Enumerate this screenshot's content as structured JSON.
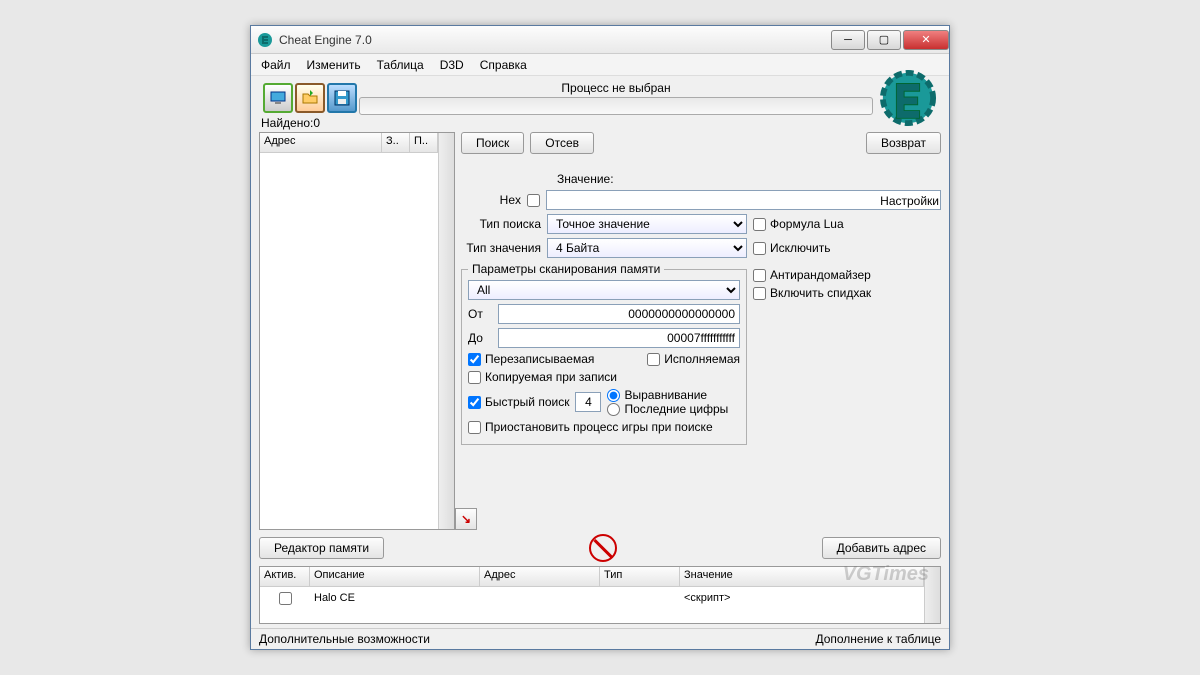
{
  "window": {
    "title": "Cheat Engine 7.0"
  },
  "menu": {
    "file": "Файл",
    "edit": "Изменить",
    "table": "Таблица",
    "d3d": "D3D",
    "help": "Справка"
  },
  "toolbar": {
    "process_status": "Процесс не выбран"
  },
  "found": {
    "label": "Найдено:",
    "count": "0"
  },
  "results_hdr": {
    "address": "Адрес",
    "val": "З..",
    "prev": "П.."
  },
  "settings_label": "Настройки",
  "buttons": {
    "search": "Поиск",
    "filter": "Отсев",
    "undo": "Возврат",
    "memedit": "Редактор памяти",
    "addaddr": "Добавить адрес"
  },
  "labels": {
    "value": "Значение:",
    "hex": "Hex",
    "scantype": "Тип поиска",
    "valtype": "Тип значения",
    "from": "От",
    "to": "До"
  },
  "scan": {
    "scantype_val": "Точное значение",
    "valtype_val": "4 Байта",
    "memscan_legend": "Параметры сканирования памяти",
    "region": "All",
    "from_val": "0000000000000000",
    "to_val": "00007fffffffffff",
    "writable": "Перезаписываемая",
    "executable": "Исполняемая",
    "copyonwrite": "Копируемая при записи",
    "fastscan": "Быстрый поиск",
    "fastscan_val": "4",
    "alignment": "Выравнивание",
    "lastdigits": "Последние цифры",
    "pause": "Приостановить процесс игры при поиске"
  },
  "opts": {
    "lua": "Формула Lua",
    "not": "Исключить",
    "antirand": "Антирандомайзер",
    "speedhack": "Включить спидхак"
  },
  "addrtable": {
    "hdr": {
      "active": "Актив.",
      "desc": "Описание",
      "addr": "Адрес",
      "type": "Тип",
      "value": "Значение"
    },
    "rows": [
      {
        "desc": "Halo CE",
        "value": "<скрипт>"
      }
    ]
  },
  "status": {
    "left": "Дополнительные возможности",
    "right": "Дополнение к таблице"
  },
  "watermark": "VGTimes"
}
